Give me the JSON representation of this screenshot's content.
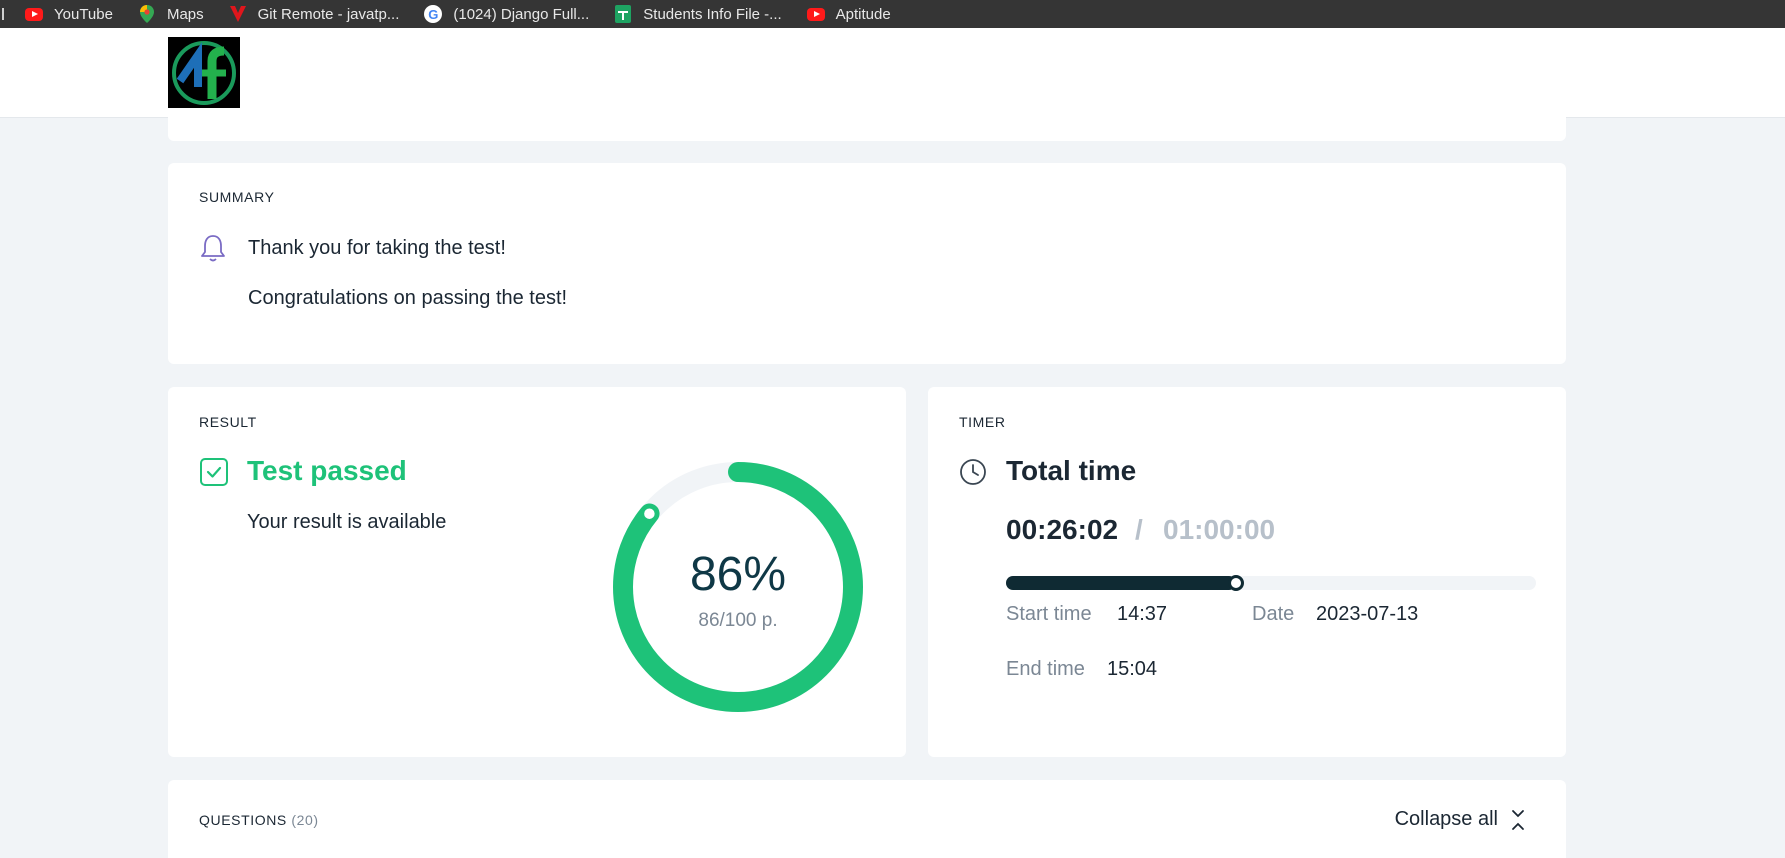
{
  "bookmarks": [
    {
      "label": "YouTube",
      "icon": "youtube-icon"
    },
    {
      "label": "Maps",
      "icon": "maps-pin-icon"
    },
    {
      "label": "Git Remote - javatp...",
      "icon": "javatpoint-icon"
    },
    {
      "label": "(1024) Django Full...",
      "icon": "google-icon"
    },
    {
      "label": "Students Info File -...",
      "icon": "sheets-icon"
    },
    {
      "label": "Aptitude",
      "icon": "youtube-icon"
    }
  ],
  "logo": {
    "icon": "brand-logo-icon"
  },
  "summary": {
    "label": "SUMMARY",
    "line1": "Thank you for taking the test!",
    "line2": "Congratulations on passing the test!"
  },
  "result": {
    "label": "RESULT",
    "title": "Test passed",
    "subtitle": "Your result is available",
    "percent_text": "86%",
    "points_text": "86/100 p.",
    "score_fraction": 0.86,
    "accent": "#1ec279"
  },
  "timer": {
    "label": "TIMER",
    "title": "Total time",
    "elapsed": "00:26:02",
    "separator": "/",
    "limit": "01:00:00",
    "progress_fraction": 0.434,
    "start_label": "Start time",
    "start_value": "14:37",
    "date_label": "Date",
    "date_value": "2023-07-13",
    "end_label": "End time",
    "end_value": "15:04"
  },
  "questions": {
    "label": "QUESTIONS",
    "count": "(20)",
    "collapse_label": "Collapse all"
  }
}
